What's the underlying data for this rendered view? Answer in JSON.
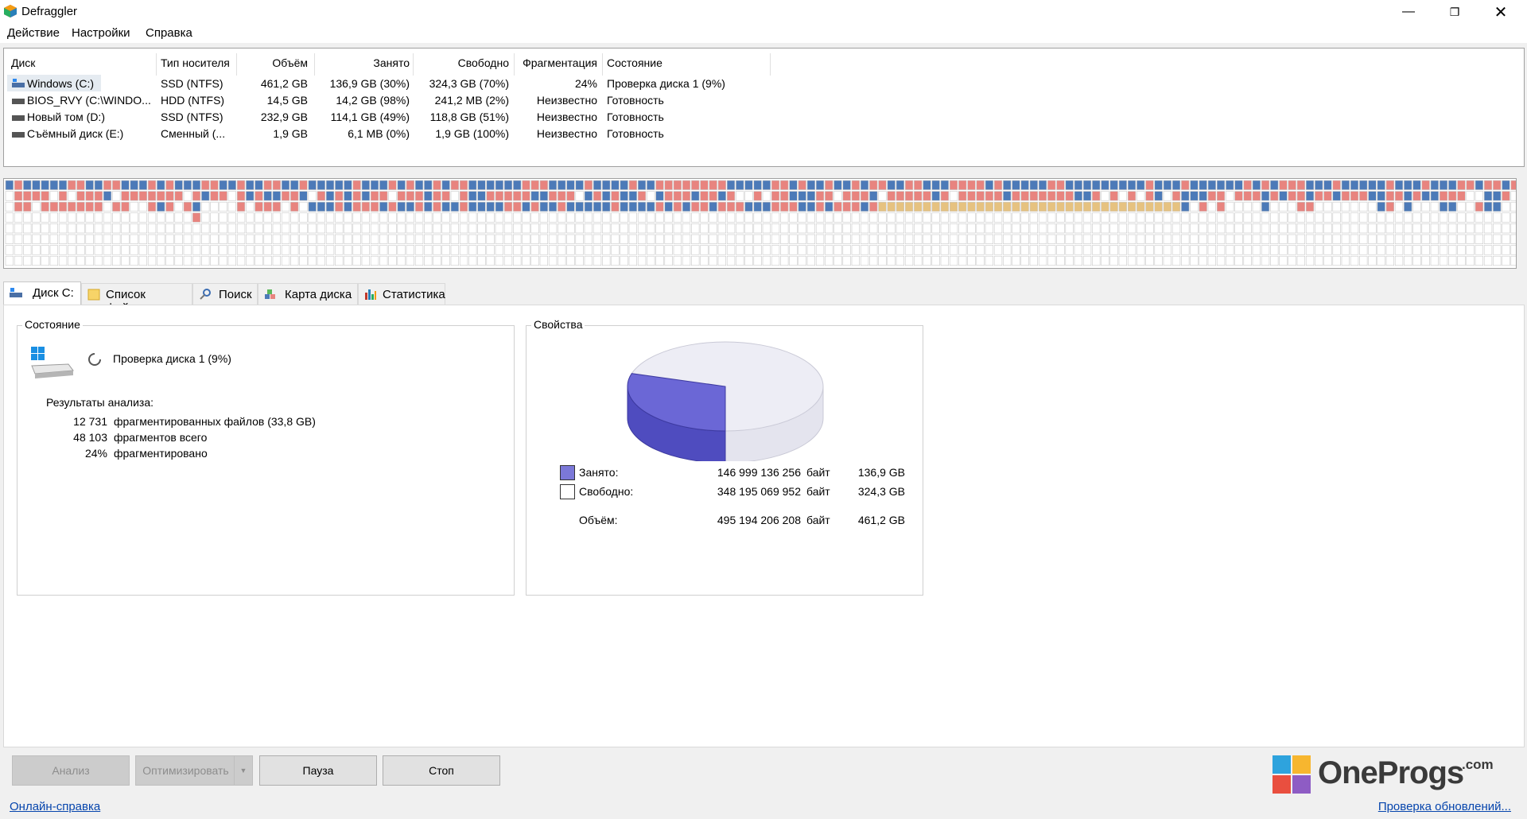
{
  "window": {
    "title": "Defraggler"
  },
  "menu": [
    "Действие",
    "Настройки",
    "Справка"
  ],
  "drive_list": {
    "headers": [
      "Диск",
      "Тип носителя",
      "Объём",
      "Занято",
      "Свободно",
      "Фрагментация",
      "Состояние"
    ],
    "rows": [
      {
        "name": "Windows (C:)",
        "type": "SSD (NTFS)",
        "size": "461,2 GB",
        "used": "136,9 GB (30%)",
        "free": "324,3 GB (70%)",
        "frag": "24%",
        "state": "Проверка диска 1 (9%)"
      },
      {
        "name": "BIOS_RVY (C:\\WINDO...",
        "type": "HDD (NTFS)",
        "size": "14,5 GB",
        "used": "14,2 GB (98%)",
        "free": "241,2 MB (2%)",
        "frag": "Неизвестно",
        "state": "Готовность"
      },
      {
        "name": "Новый том (D:)",
        "type": "SSD (NTFS)",
        "size": "232,9 GB",
        "used": "114,1 GB (49%)",
        "free": "118,8 GB (51%)",
        "frag": "Неизвестно",
        "state": "Готовность"
      },
      {
        "name": "Съёмный диск (E:)",
        "type": "Сменный (...",
        "size": "1,9 GB",
        "used": "6,1 MB (0%)",
        "free": "1,9 GB (100%)",
        "frag": "Неизвестно",
        "state": "Готовность"
      }
    ]
  },
  "tabs": [
    "Диск C:",
    "Список файлов",
    "Поиск",
    "Карта диска",
    "Статистика"
  ],
  "state_panel": {
    "label": "Состояние",
    "status": "Проверка диска 1 (9%)",
    "results_title": "Результаты анализа:",
    "results": [
      {
        "num": "12 731",
        "text": "фрагментированных файлов (33,8 GB)"
      },
      {
        "num": "48 103",
        "text": "фрагментов всего"
      },
      {
        "num": "24%",
        "text": "фрагментировано"
      }
    ]
  },
  "props_panel": {
    "label": "Свойства",
    "used_fraction": 0.297,
    "rows": [
      {
        "label": "Занято:",
        "bytes": "146 999 136 256",
        "unit": "байт",
        "gb": "136,9 GB"
      },
      {
        "label": "Свободно:",
        "bytes": "348 195 069 952",
        "unit": "байт",
        "gb": "324,3 GB"
      },
      {
        "label": "Объём:",
        "bytes": "495 194 206 208",
        "unit": "байт",
        "gb": "461,2 GB"
      }
    ]
  },
  "buttons": {
    "analyze": "Анализ",
    "optimize": "Оптимизировать",
    "pause": "Пауза",
    "stop": "Стоп"
  },
  "links": {
    "help": "Онлайн-справка",
    "updates": "Проверка обновлений..."
  },
  "logo": {
    "text": "OneProgs",
    "suffix": ".com"
  },
  "colors": {
    "used": "#6b67d6",
    "fragmented": "#e8847f",
    "contiguous": "#4c7ab8",
    "mft": "#e6c280",
    "free_block": "#ffffff",
    "accent": "#0645ad"
  }
}
